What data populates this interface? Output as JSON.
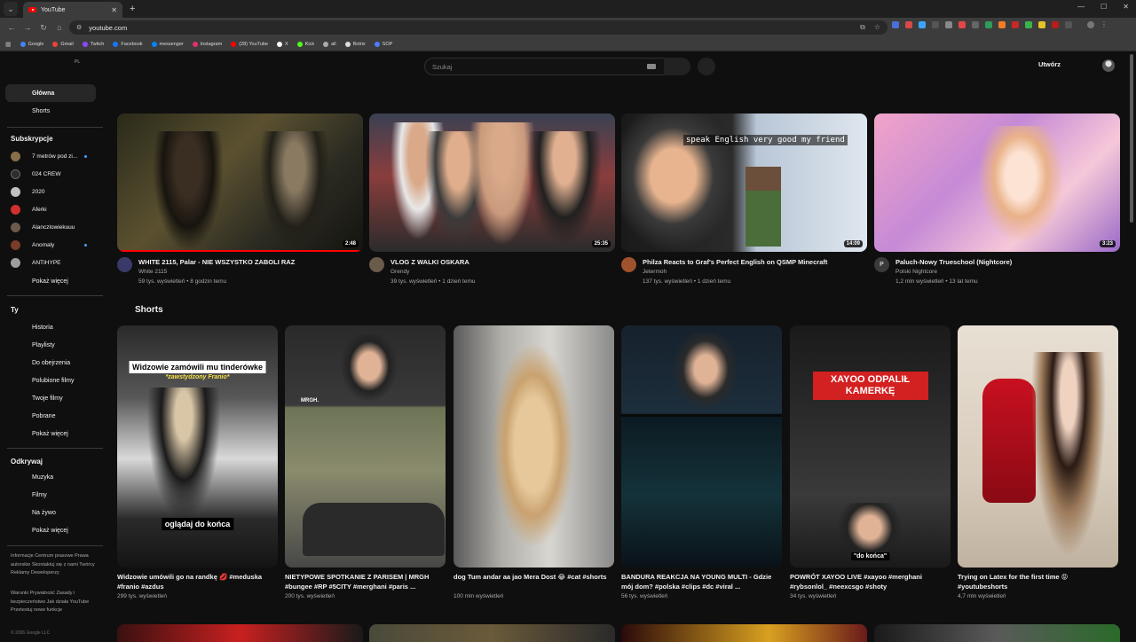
{
  "browser": {
    "tab_title": "YouTube",
    "url": "youtube.com",
    "bookmarks": [
      {
        "label": "Google",
        "color": "#4285f4"
      },
      {
        "label": "Gmail",
        "color": "#ea4335"
      },
      {
        "label": "Twitch",
        "color": "#9146ff"
      },
      {
        "label": "Facebook",
        "color": "#1877f2"
      },
      {
        "label": "messenger",
        "color": "#0084ff"
      },
      {
        "label": "Instagram",
        "color": "#e1306c"
      },
      {
        "label": "(28) YouTube",
        "color": "#ff0000"
      },
      {
        "label": "X",
        "color": "#ffffff"
      },
      {
        "label": "Kick",
        "color": "#53fc18"
      },
      {
        "label": "all",
        "color": "#aaaaaa"
      },
      {
        "label": "Botrix",
        "color": "#dddddd"
      },
      {
        "label": "SOP",
        "color": "#4f7cff"
      }
    ]
  },
  "masthead": {
    "region": "PL",
    "search_placeholder": "Szukaj",
    "create_label": "Utwórz"
  },
  "sidebar": {
    "main": [
      {
        "label": "Główna",
        "active": true
      },
      {
        "label": "Shorts",
        "active": false
      }
    ],
    "subscriptions_title": "Subskrypcje",
    "subscriptions": [
      {
        "label": "7 metrów pod zi...",
        "color": "#8a6d4a",
        "new": true
      },
      {
        "label": "024 CREW",
        "color": "#2e2e2e",
        "new": false
      },
      {
        "label": "2020",
        "color": "#c0c0c0",
        "new": false
      },
      {
        "label": "Aferki",
        "color": "#d32f2f",
        "new": false
      },
      {
        "label": "Alanczlowiekuuu",
        "color": "#6d5a4a",
        "new": false
      },
      {
        "label": "Anomaly",
        "color": "#7a3b2a",
        "new": true
      },
      {
        "label": "ANTIHYPE",
        "color": "#9e9e9e",
        "new": false
      }
    ],
    "subscriptions_more": "Pokaż więcej",
    "you_title": "Ty",
    "you": [
      "Historia",
      "Playlisty",
      "Do obejrzenia",
      "Polubione filmy",
      "Twoje filmy",
      "Pobrane",
      "Pokaż więcej"
    ],
    "explore_title": "Odkrywaj",
    "explore": [
      "Muzyka",
      "Filmy",
      "Na żywo",
      "Pokaż więcej"
    ],
    "footer_1": "Informacje  Centrum prasowe Prawa autorskie Skontaktuj się z nami  Twórcy Reklamy  Deweloperzy",
    "footer_2": "Warunki  Prywatność Zasady i bezpieczeństwo Jak działa YouTube Przetestuj nowe funkcje",
    "copyright": "© 2026 Google LLC"
  },
  "videos": [
    {
      "title": "WHITE 2115, Palar - NIE WSZYSTKO ZABOLI RAZ",
      "channel": "White 2115",
      "stats": "59 tys. wyświetleń • 8 godzin temu",
      "duration": "2:48",
      "progress": 1.0,
      "avatar_color": "#3a3a6a",
      "avatar_letter": ""
    },
    {
      "title": "VLOG Z WALKI OSKARA",
      "channel": "Grendy",
      "stats": "39 tys. wyświetleń • 1 dzień temu",
      "duration": "25:35",
      "progress": 0,
      "avatar_color": "#6b5b4b",
      "avatar_letter": ""
    },
    {
      "title": "Philza Reacts to Graf's Perfect English on QSMP Minecraft",
      "channel": "Jetermoh",
      "stats": "137 tys. wyświetleń • 1 dzień temu",
      "duration": "14:09",
      "progress": 0,
      "avatar_color": "#a0522d",
      "avatar_letter": ""
    },
    {
      "title": "Paluch-Nowy Trueschool (Nightcore)",
      "channel": "Polski Nightcore",
      "stats": "1,2 mln wyświetleń • 13 lat temu",
      "duration": "3:23",
      "progress": 0,
      "avatar_color": "#3a3a3a",
      "avatar_letter": "P"
    }
  ],
  "shorts_title": "Shorts",
  "shorts": [
    {
      "title": "Widzowie umówili go na randkę 💋 #meduska #franio #azdus",
      "views": "299 tys. wyświetleń",
      "caption_top": "Widzowie zamówili mu tinderówke",
      "caption_sub": "*zawstydzony Franio*",
      "caption_bottom": "oglądaj do końca"
    },
    {
      "title": "NIETYPOWE SPOTKANIE Z PARISEM | MRGH #bungee #RP #5CITY #merghani #paris ...",
      "views": "200 tys. wyświetleń",
      "overlay": "MRGH."
    },
    {
      "title": "dog Tum andar aa jao Mera Dost 😂 #cat #shorts",
      "views": "100 mln wyświetleń"
    },
    {
      "title": "BANDURA REAKCJA NA YOUNG MULTI - Gdzie mój dom? #polska  #clips #dc  #viral ...",
      "views": "56 tys. wyświetleń"
    },
    {
      "title": "POWRÓT XAYOO LIVE #xayoo #merghani #rybsonlol_ #neexcsgo #shoty",
      "views": "34 tys. wyświetleń",
      "caption_top": "XAYOO ODPALIŁ KAMERKĘ",
      "caption_bottom": "\"do końca\""
    },
    {
      "title": "Trying on Latex for the first time 😝 #youtubeshorts",
      "views": "4,7 mln wyświetleń"
    }
  ]
}
